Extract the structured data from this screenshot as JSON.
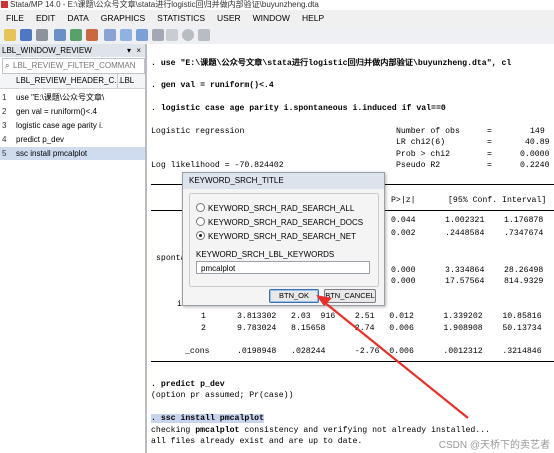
{
  "window": {
    "title": "Stata/MP 14.0 - E:\\课题\\公众号文章\\stata进行logistic回归并做内部验证\\buyunzheng.dta"
  },
  "menu": [
    "FILE",
    "EDIT",
    "DATA",
    "GRAPHICS",
    "STATISTICS",
    "USER",
    "WINDOW",
    "HELP"
  ],
  "toolbar": {
    "icons": [
      "open-icon",
      "save-icon",
      "print-icon",
      "log-icon",
      "viewer-icon",
      "graph-icon",
      "dofile-editor-icon",
      "data-editor-icon",
      "data-browser-icon",
      "variables-manager-icon",
      "more-icon",
      "break-icon",
      "stop-icon"
    ]
  },
  "review": {
    "title": "LBL_WINDOW_REVIEW",
    "filter_placeholder": "LBL_REVIEW_FILTER_COMMAN",
    "col_header": "LBL_REVIEW_HEADER_C...",
    "col_header2": "LBL",
    "rows": [
      {
        "num": "1",
        "cmd": "use \"E:\\课题\\公众号文章\\"
      },
      {
        "num": "2",
        "cmd": "gen val = runiform()<.4"
      },
      {
        "num": "3",
        "cmd": "logistic case age parity i."
      },
      {
        "num": "4",
        "cmd": "predict p_dev"
      },
      {
        "num": "5",
        "cmd": "ssc install pmcalplot"
      }
    ]
  },
  "results": {
    "line_use": ". use \"E:\\课题\\公众号文章\\stata进行logistic回归并做内部验证\\buyunzheng.dta\", cl",
    "line_gen": ". gen val = runiform()<.4",
    "line_logistic": ". logistic case age parity i.spontaneous i.induced if val==0",
    "lr_title": "Logistic regression",
    "nobs_label": "Number of obs",
    "nobs_eq": "=",
    "nobs_val": "149",
    "lrchi_label": "LR chi2(6)",
    "lrchi_eq": "=",
    "lrchi_val": "40.89",
    "prob_label": "Prob > chi2",
    "prob_eq": "=",
    "prob_val": "0.0000",
    "ll_label": "Log likelihood = -70.824402",
    "pseudo_label": "Pseudo R2",
    "pseudo_eq": "=",
    "pseudo_val": "0.2240",
    "col_pz": "P>|z|",
    "col_ci": "[95% Conf. Interval]",
    "row_age": "0.044      1.002321    1.176878",
    "row_parity": "0.002      .2448584    .7347674",
    "spont_label": "sponta",
    "row_sp1": "0.000      3.334864    28.26498",
    "row_sp2": "0.000      17.57564    814.9329",
    "ind_label": "i",
    "row_ind1_num": "1",
    "row_ind1": "3.813302   2.03  916    2.51   0.012      1.339202    10.85816",
    "row_ind2_num": "2",
    "row_ind2": "9.783024   8.15658      2.74   0.006      1.908908    50.13734",
    "row_cons_label": "_cons",
    "row_cons": ".0198948   .028244      -2.76  0.006      .0012312    .3214846",
    "line_predict": ". predict p_dev",
    "line_predict_note": "(option pr assumed; Pr(case))",
    "line_ssc": ". ssc install pmcalplot",
    "line_check_pre": "checking ",
    "line_check_bold": "pmcalplot",
    "line_check_post": " consistency and verifying not already installed...",
    "line_files": "all files already exist and are up to date."
  },
  "dialog": {
    "title": "KEYWORD_SRCH_TITLE",
    "radio_all": "KEYWORD_SRCH_RAD_SEARCH_ALL",
    "radio_docs": "KEYWORD_SRCH_RAD_SEARCH_DOCS",
    "radio_net": "KEYWORD_SRCH_RAD_SEARCH_NET",
    "selected": "net",
    "keywords_label": "KEYWORD_SRCH_LBL_KEYWORDS",
    "keywords_value": "pmcalplot",
    "ok_label": "BTN_OK",
    "cancel_label": "BTN_CANCEL"
  },
  "watermark": "CSDN @天桥下的卖艺者",
  "colors": {
    "arrow": "#e8302a",
    "highlight": "#c8d4ee",
    "selected_row": "#cfdbef"
  }
}
